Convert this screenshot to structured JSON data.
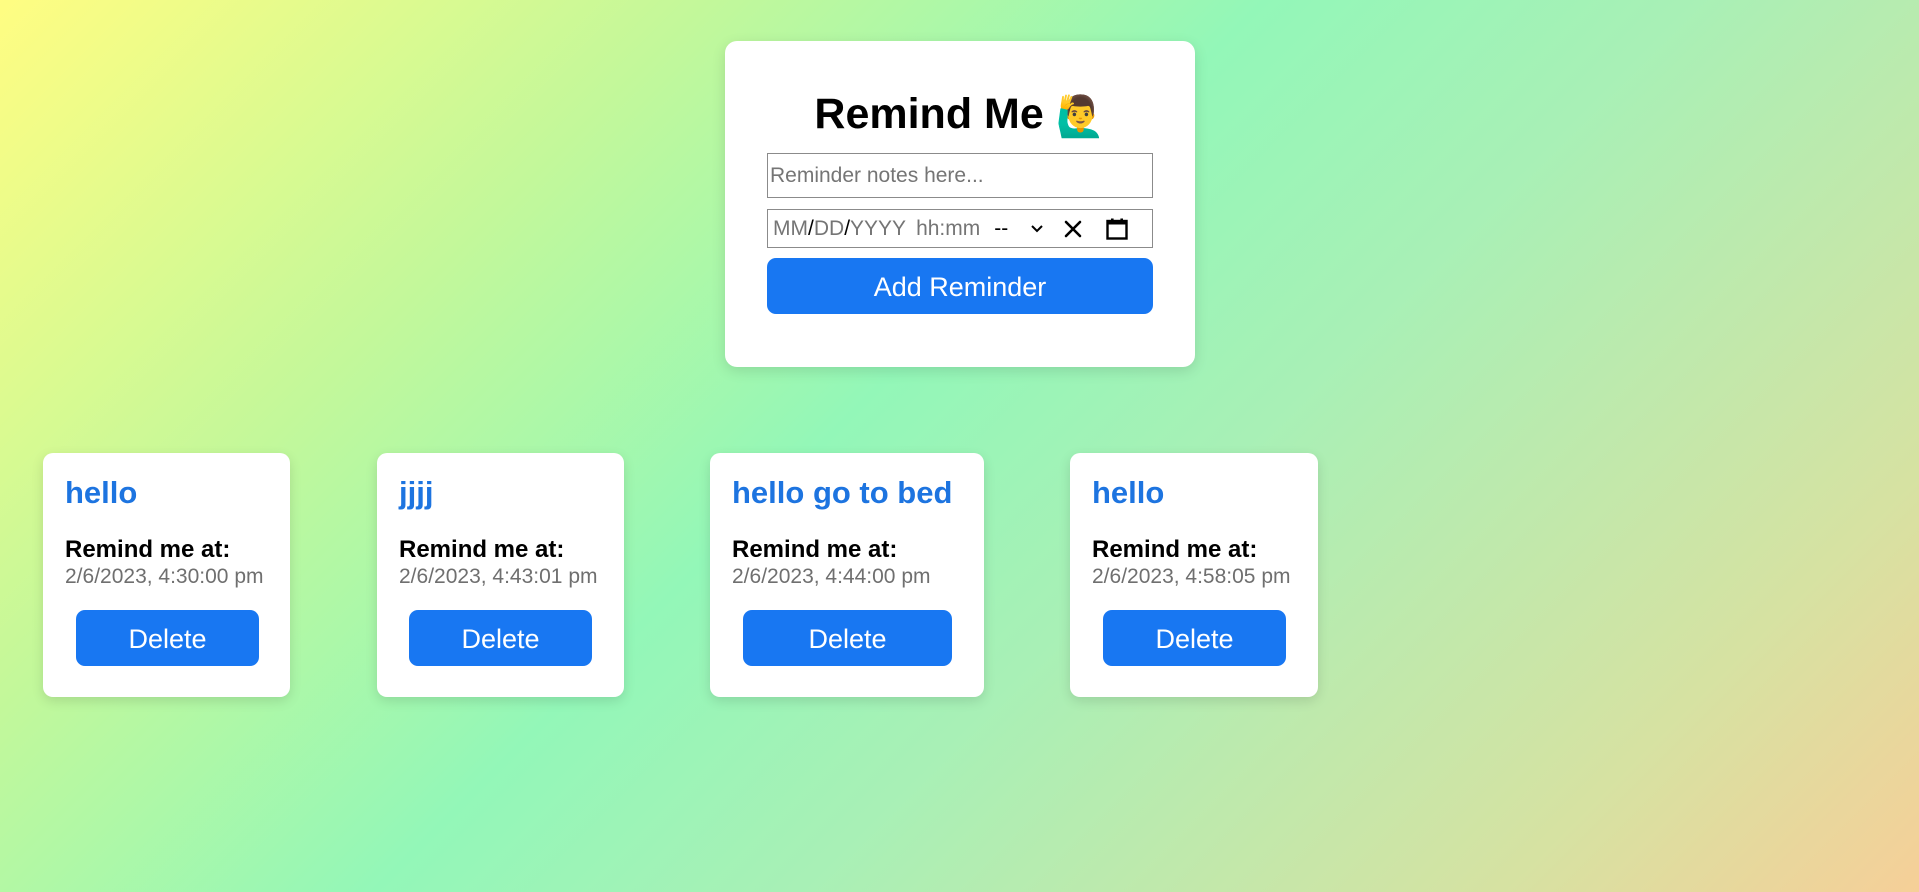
{
  "app": {
    "title": "Remind Me",
    "title_emoji": "🙋‍♂️"
  },
  "form": {
    "notes_placeholder": "Reminder notes here...",
    "notes_value": "",
    "datetime": {
      "month": "MM",
      "day": "DD",
      "year": "YYYY",
      "sep": "/",
      "time": "hh:mm",
      "ampm": "--"
    },
    "add_button_label": "Add Reminder"
  },
  "reminders": [
    {
      "title": "hello",
      "label": "Remind me at:",
      "time": "2/6/2023, 4:30:00 pm",
      "delete_label": "Delete"
    },
    {
      "title": "jjjj",
      "label": "Remind me at:",
      "time": "2/6/2023, 4:43:01 pm",
      "delete_label": "Delete"
    },
    {
      "title": "hello go to bed",
      "label": "Remind me at:",
      "time": "2/6/2023, 4:44:00 pm",
      "delete_label": "Delete"
    },
    {
      "title": "hello",
      "label": "Remind me at:",
      "time": "2/6/2023, 4:58:05 pm",
      "delete_label": "Delete"
    }
  ],
  "colors": {
    "accent": "#1877f2",
    "reminder_title": "#1d74e0",
    "muted_text": "#6f6f6f"
  }
}
